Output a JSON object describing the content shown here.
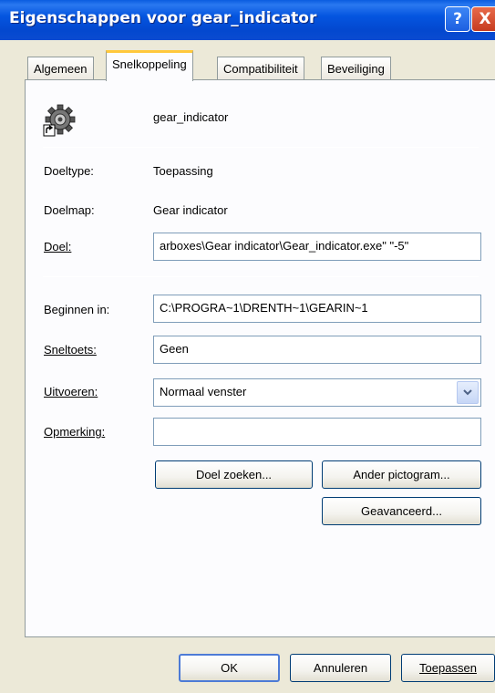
{
  "window": {
    "title": "Eigenschappen voor gear_indicator",
    "help_symbol": "?",
    "close_symbol": "X"
  },
  "tabs": [
    {
      "label": "Algemeen",
      "active": false
    },
    {
      "label": "Snelkoppeling",
      "active": true
    },
    {
      "label": "Compatibiliteit",
      "active": false
    },
    {
      "label": "Beveiliging",
      "active": false
    }
  ],
  "shortcut": {
    "icon": "gear-shortcut-icon",
    "name": "gear_indicator",
    "target_type_label": "Doeltype:",
    "target_type_value": "Toepassing",
    "target_folder_label": "Doelmap:",
    "target_folder_value": "Gear indicator",
    "target_label": "Doel:",
    "target_value": "arboxes\\Gear indicator\\Gear_indicator.exe\" \"-5\"",
    "start_in_label": "Beginnen in:",
    "start_in_value": "C:\\PROGRA~1\\DRENTH~1\\GEARIN~1",
    "shortcut_key_label": "Sneltoets:",
    "shortcut_key_value": "Geen",
    "run_label": "Uitvoeren:",
    "run_value": "Normaal venster",
    "comment_label": "Opmerking:",
    "comment_value": "",
    "find_target_button": "Doel zoeken...",
    "change_icon_button": "Ander pictogram...",
    "advanced_button": "Geavanceerd..."
  },
  "footer": {
    "ok_button": "OK",
    "cancel_button": "Annuleren",
    "apply_button": "Toepassen"
  }
}
